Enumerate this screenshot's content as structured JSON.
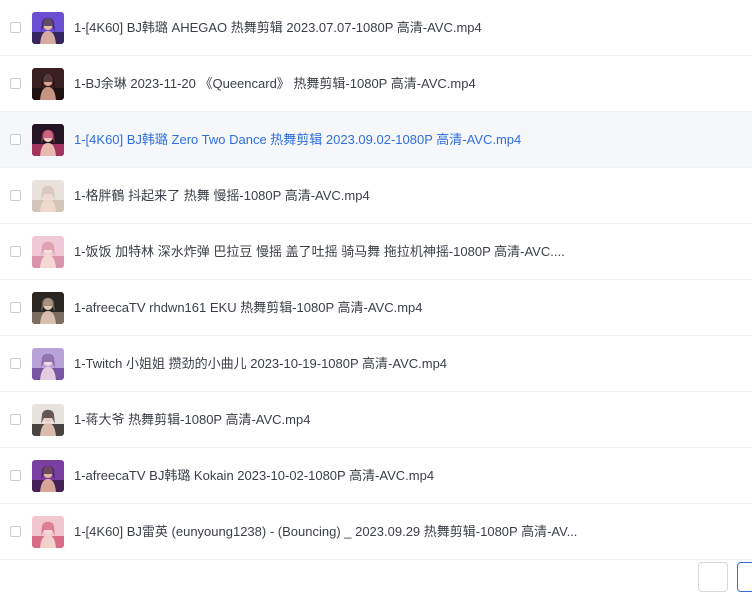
{
  "files": [
    {
      "name": "1-[4K60] BJ韩璐 AHEGAO 热舞剪辑 2023.07.07-1080P 高清-AVC.mp4",
      "thumb_colors": [
        "#6a4fd3",
        "#2a1d4a",
        "#e8b9a8"
      ],
      "thumb_icon": "video-thumbnail-icon"
    },
    {
      "name": "1-BJ余琳 2023-11-20 《Queencard》 热舞剪辑-1080P 高清-AVC.mp4",
      "thumb_colors": [
        "#3a2020",
        "#1c0f0f",
        "#d9a38f"
      ],
      "thumb_icon": "video-thumbnail-icon"
    },
    {
      "name": "1-[4K60] BJ韩璐 Zero Two Dance 热舞剪辑 2023.09.02-1080P 高清-AVC.mp4",
      "thumb_colors": [
        "#241424",
        "#b83a6a",
        "#f0c8b8"
      ],
      "thumb_icon": "video-thumbnail-icon"
    },
    {
      "name": "1-格胖鶴 抖起来了 热舞 慢摇-1080P 高清-AVC.mp4",
      "thumb_colors": [
        "#e9e1dc",
        "#cfc0b6",
        "#f3dacd"
      ],
      "thumb_icon": "video-thumbnail-icon"
    },
    {
      "name": "1-饭饭 加特林 深水炸弹 巴拉豆 慢摇 盖了吐摇 骑马舞 拖拉机神摇-1080P 高清-AVC....",
      "thumb_colors": [
        "#f0c9d6",
        "#d48aa3",
        "#f6e0d8"
      ],
      "thumb_icon": "video-thumbnail-icon"
    },
    {
      "name": "1-afreecaTV rhdwn161 EKU 热舞剪辑-1080P 高清-AVC.mp4",
      "thumb_colors": [
        "#2a2622",
        "#8a7a6a",
        "#e3c7b4"
      ],
      "thumb_icon": "video-thumbnail-icon"
    },
    {
      "name": "1-Twitch 小姐姐 攒劲的小曲儿 2023-10-19-1080P 高清-AVC.mp4",
      "thumb_colors": [
        "#b7a3d8",
        "#6e4a9a",
        "#f0d8e4"
      ],
      "thumb_icon": "video-thumbnail-icon"
    },
    {
      "name": "1-蒋大爷 热舞剪辑-1080P 高清-AVC.mp4",
      "thumb_colors": [
        "#e6e2de",
        "#2c2624",
        "#e9c9b8"
      ],
      "thumb_icon": "video-thumbnail-icon"
    },
    {
      "name": "1-afreecaTV BJ韩璐 Kokain 2023-10-02-1080P 高清-AVC.mp4",
      "thumb_colors": [
        "#7a3fa0",
        "#3a1c4a",
        "#e8b3a0"
      ],
      "thumb_icon": "video-thumbnail-icon"
    },
    {
      "name": "1-[4K60] BJ雷英 (eunyoung1238) - (Bouncing) _ 2023.09.29 热舞剪辑-1080P 高清-AV...",
      "thumb_colors": [
        "#f2c6d0",
        "#d35a7a",
        "#f6dcd2"
      ],
      "thumb_icon": "video-thumbnail-icon"
    }
  ],
  "hover_row_index": 2,
  "colors": {
    "text": "#3b3f46",
    "hover_text": "#2d6fe0",
    "hover_bg": "#f5f7fb",
    "accent": "#2d6fe0"
  }
}
